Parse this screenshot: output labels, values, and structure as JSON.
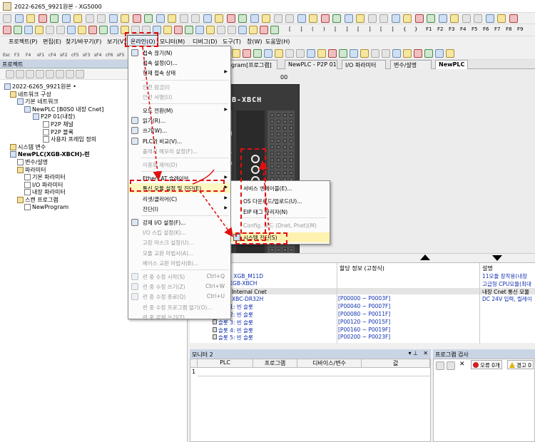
{
  "titlebar": {
    "title": "2022-6265_9921원본 - XG5000"
  },
  "toolbar_row2_labels": [
    "[",
    "]",
    "(",
    ")",
    "[",
    "]",
    "[",
    "]",
    "[",
    "]",
    "{",
    "}",
    "F1",
    "F2",
    "F3",
    "F4",
    "F5",
    "F6",
    "F7",
    "F8",
    "F9"
  ],
  "toolbar_row3_labels": [
    "Esc",
    "F3",
    "F4",
    "sF1",
    "cF4",
    "sF2",
    "cF5",
    "sF3",
    "sF4",
    "cF6",
    "sF5"
  ],
  "menu": {
    "items": [
      "프로젝트(P)",
      "편집(E)",
      "찾기/바꾸기(F)",
      "보기(V)",
      "온라인(O)",
      "모니터(M)",
      "디버그(D)",
      "도구(T)",
      "창(W)",
      "도움말(H)"
    ]
  },
  "project": {
    "header": "프로젝트",
    "tree": [
      {
        "label": "2022-6265_9921원본 •",
        "bold": false
      },
      {
        "label": "네트워크 구성",
        "bold": false
      },
      {
        "label": "기본 네트워크",
        "bold": false
      },
      {
        "label": "NewPLC [B0S0 내장 Cnet]",
        "bold": false
      },
      {
        "label": "P2P 01(내장)",
        "bold": false
      },
      {
        "label": "P2P 채널",
        "bold": false
      },
      {
        "label": "P2P 블록",
        "bold": false
      },
      {
        "label": "사용자 프레임 정의",
        "bold": false
      },
      {
        "label": "시스템 변수",
        "bold": false
      },
      {
        "label": "NewPLC(XGB-XBCH)-런",
        "bold": true
      },
      {
        "label": "변수/설명",
        "bold": false
      },
      {
        "label": "파라미터",
        "bold": false
      },
      {
        "label": "기본 파라미터",
        "bold": false
      },
      {
        "label": "I/O 파라미터",
        "bold": false
      },
      {
        "label": "내장 파라미터",
        "bold": false
      },
      {
        "label": "스캔 프로그램",
        "bold": false
      },
      {
        "label": "NewProgram",
        "bold": false
      }
    ]
  },
  "tabs": [
    "rogram[프로그램]",
    "NewPLC - P2P 01",
    "I/O 파라미터",
    "변수/설명",
    "NewPLC"
  ],
  "editor": {
    "slot_label": "00",
    "plc_label": "XGB-XBCH",
    "side_letters": [
      "N",
      "0",
      "P",
      "D"
    ]
  },
  "io_table": {
    "headers": [
      "할당 정보 (고정식)",
      "설명"
    ],
    "rows": [
      {
        "c0": "스 0 : XGB_M11D",
        "c1": "",
        "c2": "11모듈 장착용(내장"
      },
      {
        "c0": "PU: XGB-XBCH",
        "c1": "",
        "c2": "고급형 CPU모듈(최대"
      },
      {
        "c0": "롯 0: Internal Cnet",
        "c1": "",
        "c2": "내장 Cnet 통신 모듈"
      },
      {
        "c0": "롯 0: XBC-DR32H",
        "c1": "[P00000 ~ P0003F]",
        "c2": "DC 24V 입력, 릴레이"
      },
      {
        "c0": "슬롯 1: 빈 슬롯",
        "c1": "[P00040 ~ P0007F]",
        "c2": ""
      },
      {
        "c0": "슬롯 2: 빈 슬롯",
        "c1": "[P00080 ~ P0011F]",
        "c2": ""
      },
      {
        "c0": "슬롯 3: 빈 슬롯",
        "c1": "[P00120 ~ P0015F]",
        "c2": ""
      },
      {
        "c0": "슬롯 4: 빈 슬롯",
        "c1": "[P00160 ~ P0019F]",
        "c2": ""
      },
      {
        "c0": "슬롯 5: 빈 슬롯",
        "c1": "[P00200 ~ P0023F]",
        "c2": ""
      }
    ]
  },
  "monitor": {
    "header": "모니터 2",
    "columns": [
      "PLC",
      "프로그램",
      "디바이스/변수",
      "값"
    ],
    "row_index": "1"
  },
  "check": {
    "header": "프로그램 검사",
    "errors": "오류 0개",
    "warnings": "경고 0"
  },
  "online_menu": {
    "items": [
      {
        "label": "접속 끊기(N)",
        "shortcut": "",
        "disabled": false,
        "submenu": false
      },
      {
        "label": "접속 설정(O)...",
        "shortcut": "",
        "disabled": false,
        "submenu": false
      },
      {
        "label": "현재 접속 상태",
        "shortcut": "",
        "disabled": false,
        "submenu": true
      },
      {
        "label": "안전 잠금(I)",
        "shortcut": "",
        "disabled": true,
        "submenu": false
      },
      {
        "label": "안전 서명(U)",
        "shortcut": "",
        "disabled": true,
        "submenu": false
      },
      {
        "label": "모드 전환(M)",
        "shortcut": "",
        "disabled": false,
        "submenu": true
      },
      {
        "label": "읽기(R)...",
        "shortcut": "",
        "disabled": false,
        "submenu": false
      },
      {
        "label": "쓰기(W)...",
        "shortcut": "",
        "disabled": false,
        "submenu": false
      },
      {
        "label": "PLC와 비교(V)...",
        "shortcut": "",
        "disabled": false,
        "submenu": false
      },
      {
        "label": "플래시 메모리 설정(F)...",
        "shortcut": "",
        "disabled": true,
        "submenu": false
      },
      {
        "label": "이중화 제어(D)",
        "shortcut": "",
        "disabled": true,
        "submenu": false
      },
      {
        "label": "EtherCAT 슬레이브",
        "shortcut": "",
        "disabled": false,
        "submenu": true
      },
      {
        "label": "통신 모듈 설정 및 진단(E)",
        "shortcut": "",
        "disabled": false,
        "submenu": true
      },
      {
        "label": "리셋/클리어(C)",
        "shortcut": "",
        "disabled": false,
        "submenu": true
      },
      {
        "label": "진단(I)",
        "shortcut": "",
        "disabled": false,
        "submenu": true
      },
      {
        "label": "강제 I/O 설정(F)...",
        "shortcut": "",
        "disabled": false,
        "submenu": false
      },
      {
        "label": "I/O 스킵 설정(K)...",
        "shortcut": "",
        "disabled": true,
        "submenu": false
      },
      {
        "label": "고장 마스크 설정(U)...",
        "shortcut": "",
        "disabled": true,
        "submenu": false
      },
      {
        "label": "모듈 교환 마법사(A)...",
        "shortcut": "",
        "disabled": true,
        "submenu": false
      },
      {
        "label": "베이스 교환 마법사(B)...",
        "shortcut": "",
        "disabled": true,
        "submenu": false
      },
      {
        "label": "런 중 수정 시작(S)",
        "shortcut": "Ctrl+Q",
        "disabled": true,
        "submenu": false
      },
      {
        "label": "런 중 수정 쓰기(Z)",
        "shortcut": "Ctrl+W",
        "disabled": true,
        "submenu": false
      },
      {
        "label": "런 중 수정 종료(Q)",
        "shortcut": "Ctrl+U",
        "disabled": true,
        "submenu": false
      },
      {
        "label": "런 중 수정 프로그램 열기(O)...",
        "shortcut": "",
        "disabled": true,
        "submenu": false
      },
      {
        "label": "런 중 강제 쓰기(T)...",
        "shortcut": "",
        "disabled": true,
        "submenu": false
      }
    ]
  },
  "comm_submenu": {
    "items": [
      {
        "label": "서비스 엔에이블(E)...",
        "disabled": false
      },
      {
        "label": "OS 다운로드/업로드(U)...",
        "disabled": false
      },
      {
        "label": "EIP 태그 관리자(N)",
        "disabled": false
      },
      {
        "label": "Config. 로드 (Dnet, Pnet)(M)",
        "disabled": true
      },
      {
        "label": "시스템 진단(S)",
        "disabled": false
      }
    ]
  },
  "colors": {
    "highlight": "#e01010",
    "link_text": "#1030b0",
    "panel_header": "#c9d5e5"
  }
}
